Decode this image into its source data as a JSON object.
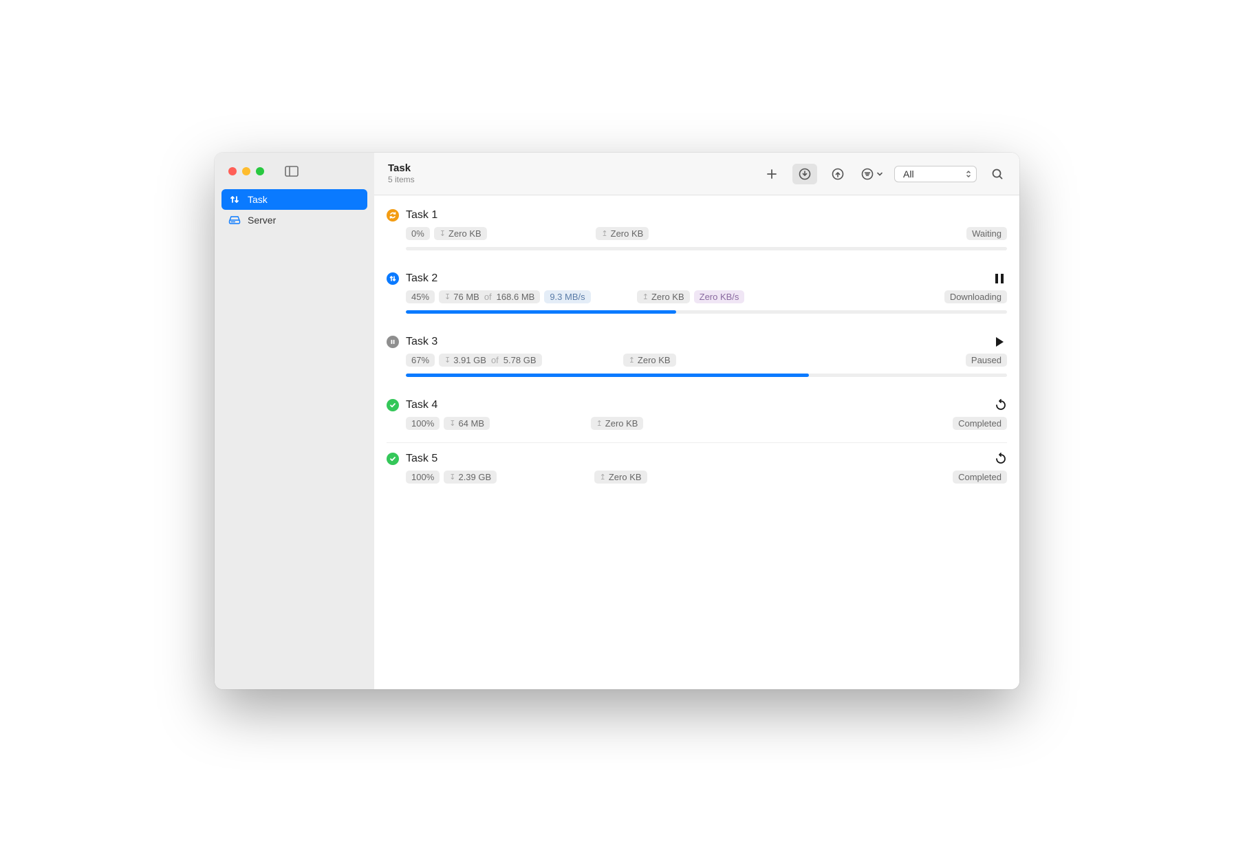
{
  "header": {
    "title": "Task",
    "subtitle": "5 items"
  },
  "sidebar": {
    "items": [
      {
        "label": "Task",
        "icon": "updown"
      },
      {
        "label": "Server",
        "icon": "drive"
      }
    ]
  },
  "toolbar": {
    "filter_label": "All"
  },
  "tasks": [
    {
      "name": "Task 1",
      "status": "Waiting",
      "status_color": "#f39c12",
      "status_icon": "sync",
      "percent": "0%",
      "down": "Zero KB",
      "down_of": "",
      "down_rate": "",
      "up": "Zero KB",
      "up_rate": "",
      "progress": 0,
      "action": "none",
      "show_progress": true,
      "tiny_progress": true
    },
    {
      "name": "Task 2",
      "status": "Downloading",
      "status_color": "#0a7aff",
      "status_icon": "updown",
      "percent": "45%",
      "down": "76 MB",
      "down_of": "168.6 MB",
      "down_rate": "9.3 MB/s",
      "up": "Zero KB",
      "up_rate": "Zero KB/s",
      "progress": 45,
      "action": "pause",
      "show_progress": true,
      "tiny_progress": false
    },
    {
      "name": "Task 3",
      "status": "Paused",
      "status_color": "#8e8e8e",
      "status_icon": "pause",
      "percent": "67%",
      "down": "3.91 GB",
      "down_of": "5.78 GB",
      "down_rate": "",
      "up": "Zero KB",
      "up_rate": "",
      "progress": 67,
      "action": "play",
      "show_progress": true,
      "tiny_progress": false
    },
    {
      "name": "Task 4",
      "status": "Completed",
      "status_color": "#34c759",
      "status_icon": "check",
      "percent": "100%",
      "down": "64 MB",
      "down_of": "",
      "down_rate": "",
      "up": "Zero KB",
      "up_rate": "",
      "progress": 100,
      "action": "restart",
      "show_progress": false,
      "tiny_progress": false
    },
    {
      "name": "Task 5",
      "status": "Completed",
      "status_color": "#34c759",
      "status_icon": "check",
      "percent": "100%",
      "down": "2.39 GB",
      "down_of": "",
      "down_rate": "",
      "up": "Zero KB",
      "up_rate": "",
      "progress": 100,
      "action": "restart",
      "show_progress": false,
      "tiny_progress": false
    }
  ]
}
